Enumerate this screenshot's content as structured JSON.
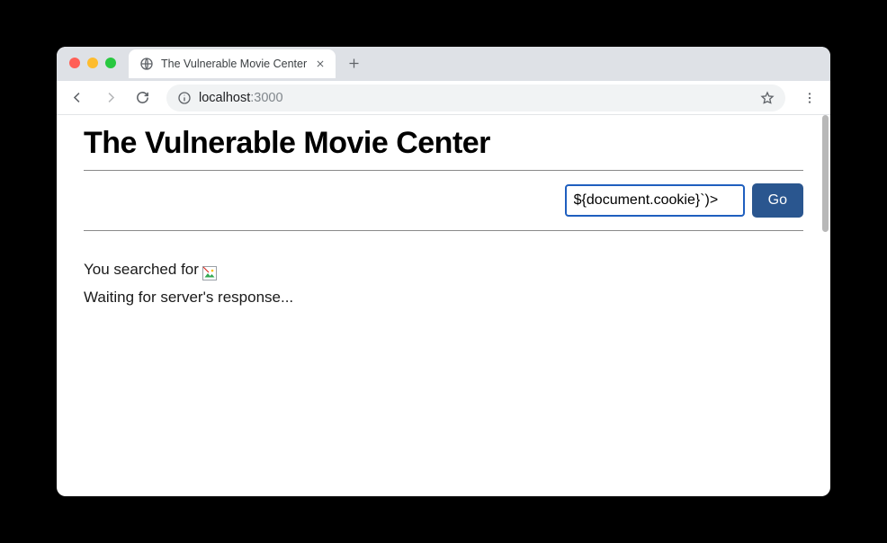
{
  "browser": {
    "tab_title": "The Vulnerable Movie Center",
    "url_host": "localhost",
    "url_port": ":3000"
  },
  "page": {
    "title": "The Vulnerable Movie Center",
    "search_value": "${document.cookie}`)>",
    "go_label": "Go",
    "searched_prefix": "You searched for ",
    "waiting_text": "Waiting for server's response..."
  }
}
